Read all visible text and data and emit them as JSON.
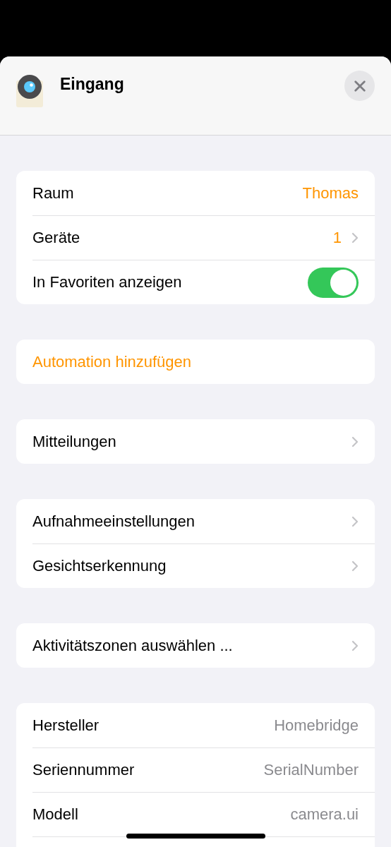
{
  "header": {
    "title": "Eingang"
  },
  "groups": [
    {
      "rows": [
        {
          "kind": "value",
          "label": "Raum",
          "value": "Thomas",
          "accent": true,
          "chevron": false
        },
        {
          "kind": "value",
          "label": "Geräte",
          "value": "1",
          "accent": true,
          "chevron": true
        },
        {
          "kind": "toggle",
          "label": "In Favoriten anzeigen",
          "on": true
        }
      ]
    },
    {
      "rows": [
        {
          "kind": "action",
          "label": "Automation hinzufügen"
        }
      ]
    },
    {
      "rows": [
        {
          "kind": "value",
          "label": "Mitteilungen",
          "chevron": true
        }
      ]
    },
    {
      "rows": [
        {
          "kind": "value",
          "label": "Aufnahmeeinstellungen",
          "chevron": true
        },
        {
          "kind": "value",
          "label": "Gesichtserkennung",
          "chevron": true
        }
      ]
    },
    {
      "rows": [
        {
          "kind": "value",
          "label": "Aktivitätszonen auswählen ...",
          "chevron": true
        }
      ]
    },
    {
      "rows": [
        {
          "kind": "value",
          "label": "Hersteller",
          "value": "Homebridge",
          "accent": false,
          "chevron": false
        },
        {
          "kind": "value",
          "label": "Seriennummer",
          "value": "SerialNumber",
          "accent": false,
          "chevron": false
        },
        {
          "kind": "value",
          "label": "Modell",
          "value": "camera.ui",
          "accent": false,
          "chevron": false
        },
        {
          "kind": "blank"
        }
      ]
    }
  ]
}
